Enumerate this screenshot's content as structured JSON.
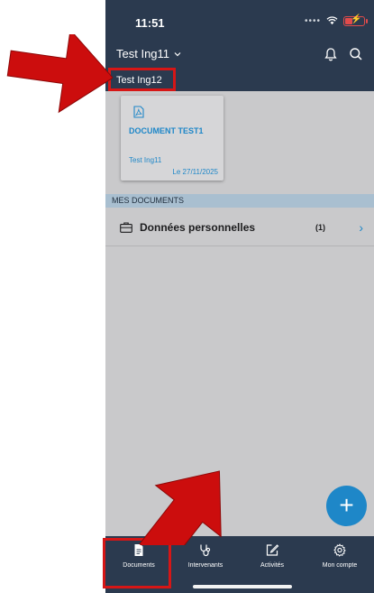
{
  "status": {
    "time": "11:51"
  },
  "header": {
    "account_name": "Test Ing11",
    "sub_account": "Test Ing12"
  },
  "document_card": {
    "title": "DOCUMENT TEST1",
    "owner": "Test Ing11",
    "date": "Le 27/11/2025"
  },
  "section": {
    "title": "MES DOCUMENTS"
  },
  "folders": [
    {
      "label": "Données personnelles",
      "count": "(1)"
    }
  ],
  "fab": {
    "label": "+"
  },
  "tabs": [
    {
      "label": "Documents",
      "icon": "document-icon"
    },
    {
      "label": "Intervenants",
      "icon": "stethoscope-icon"
    },
    {
      "label": "Activités",
      "icon": "edit-icon"
    },
    {
      "label": "Mon compte",
      "icon": "gear-icon"
    }
  ],
  "colors": {
    "header_bg": "#2b3a4f",
    "accent": "#1e87c8",
    "highlight": "#d61616",
    "section_bg": "#a9bfd0"
  }
}
